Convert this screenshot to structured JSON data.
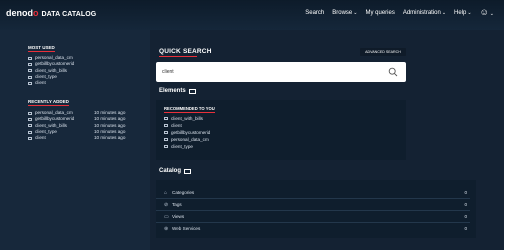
{
  "header": {
    "brand_pre": "denod",
    "brand_o": "o",
    "product": "DATA CATALOG",
    "nav": {
      "search": "Search",
      "browse": "Browse",
      "my_queries": "My queries",
      "administration": "Administration",
      "help": "Help"
    },
    "caret": "⌄",
    "user_icon": "☺"
  },
  "most_used": {
    "title": "MOST USED",
    "items": [
      {
        "label": "personal_data_cm"
      },
      {
        "label": "getbillbycustomerid"
      },
      {
        "label": "client_with_bills"
      },
      {
        "label": "client_type"
      },
      {
        "label": "client"
      }
    ]
  },
  "recently_added": {
    "title": "RECENTLY ADDED",
    "items": [
      {
        "label": "personal_data_cm",
        "when": "10 minutes ago"
      },
      {
        "label": "getbillbycustomerid",
        "when": "10 minutes ago"
      },
      {
        "label": "client_with_bills",
        "when": "10 minutes ago"
      },
      {
        "label": "client_type",
        "when": "10 minutes ago"
      },
      {
        "label": "client",
        "when": "10 minutes ago"
      }
    ]
  },
  "quick_search": {
    "title": "QUICK SEARCH",
    "advanced_label": "ADVANCED SEARCH",
    "value": "client",
    "icon": "search-icon"
  },
  "elements": {
    "title": "Elements",
    "recommended_title": "RECOMMENDED TO YOU",
    "items": [
      {
        "label": "client_with_bills"
      },
      {
        "label": "client"
      },
      {
        "label": "getbillbycustomerid"
      },
      {
        "label": "personal_data_cm"
      },
      {
        "label": "client_type"
      }
    ]
  },
  "catalog": {
    "title": "Catalog",
    "rows": [
      {
        "icon": "⌂",
        "label": "Categories",
        "count": "0"
      },
      {
        "icon": "⊘",
        "label": "Tags",
        "count": "0"
      },
      {
        "icon": "▭",
        "label": "Views",
        "count": "0"
      },
      {
        "icon": "⊛",
        "label": "Web Services",
        "count": "0"
      }
    ]
  }
}
